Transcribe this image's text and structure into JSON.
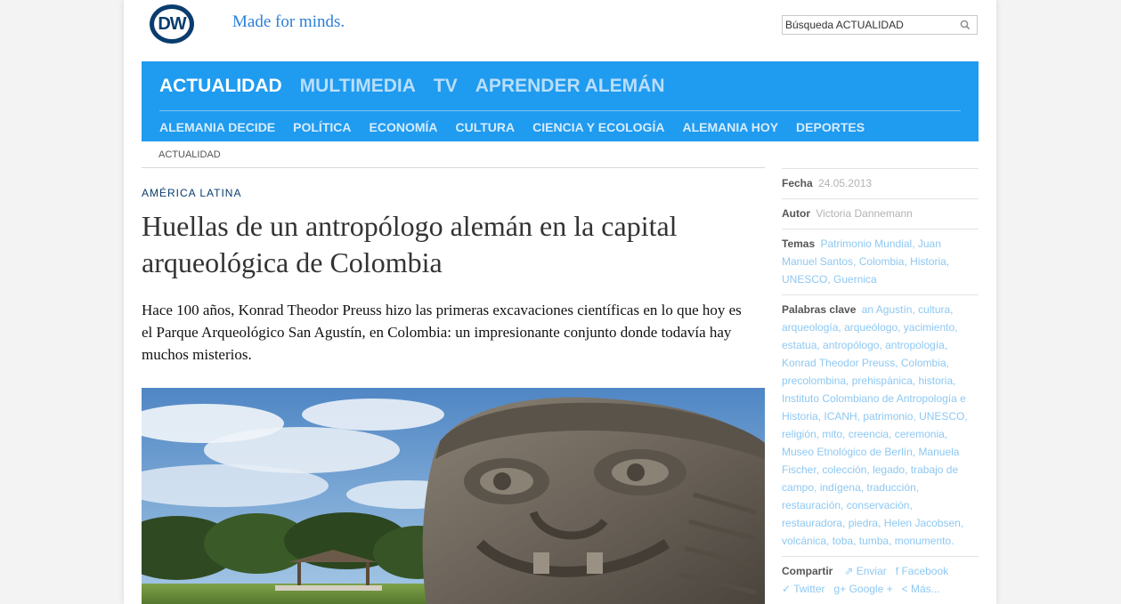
{
  "header": {
    "logo_text": "DW",
    "tagline": "Made for minds.",
    "search_value": "Búsqueda ACTUALIDAD"
  },
  "colors": {
    "nav_bg": "#1f9bf0",
    "brand_navy": "#0a3c6e",
    "link_blue": "#8ec8f2"
  },
  "nav": {
    "main": [
      {
        "label": "ACTUALIDAD",
        "active": true
      },
      {
        "label": "MULTIMEDIA",
        "active": false
      },
      {
        "label": "TV",
        "active": false
      },
      {
        "label": "APRENDER ALEMÁN",
        "active": false
      }
    ],
    "sub": [
      "ALEMANIA DECIDE",
      "POLÍTICA",
      "ECONOMÍA",
      "CULTURA",
      "CIENCIA Y ECOLOGÍA",
      "ALEMANIA HOY",
      "DEPORTES"
    ]
  },
  "breadcrumb": "ACTUALIDAD",
  "article": {
    "kicker": "AMÉRICA LATINA",
    "headline": "Huellas de un antropólogo alemán en la capital arqueológica de Colombia",
    "lead": "Hace 100 años, Konrad Theodor Preuss hizo las primeras excavaciones científicas en lo que hoy es el Parque Arqueológico San Agustín, en Colombia: un impresionante conjunto donde todavía hay muchos misterios."
  },
  "sidebar": {
    "date_label": "Fecha",
    "date": "24.05.2013",
    "author_label": "Autor",
    "author": "Victoria Dannemann",
    "topics_label": "Temas",
    "topics": [
      "Patrimonio Mundial",
      "Juan Manuel Santos",
      "Colombia",
      "Historia",
      "UNESCO",
      "Guernica"
    ],
    "keywords_label": "Palabras clave",
    "keywords": [
      "an Agustín",
      "cultura",
      "arqueología",
      "arqueólogo",
      "yacimiento",
      "estatua",
      "antropólogo",
      "antropología",
      "Konrad Theodor Preuss",
      "Colombia",
      "precolombina",
      "prehispánica",
      "historia",
      "Instituto Colombiano de Antropología e Historia",
      "ICANH",
      "patrimonio",
      "UNESCO",
      "religión",
      "mito",
      "creencia",
      "ceremonia",
      "Museo Etnológico de Berlín",
      "Manuela Fischer",
      "colección",
      "legado",
      "trabajo de campo",
      "indígena",
      "traducción",
      "restauración",
      "conservación",
      "restauradora",
      "piedra",
      "Helen Jacobsen",
      "volcánica",
      "toba",
      "tumba",
      "monumento."
    ],
    "share_label": "Compartir",
    "share": [
      {
        "label": "Enviar",
        "icon": "share-icon"
      },
      {
        "label": "Facebook",
        "icon": "facebook-icon"
      },
      {
        "label": "Twitter",
        "icon": "twitter-icon"
      },
      {
        "label": "Google +",
        "icon": "google-plus-icon"
      },
      {
        "label": "Más...",
        "icon": "more-share-icon"
      }
    ]
  }
}
